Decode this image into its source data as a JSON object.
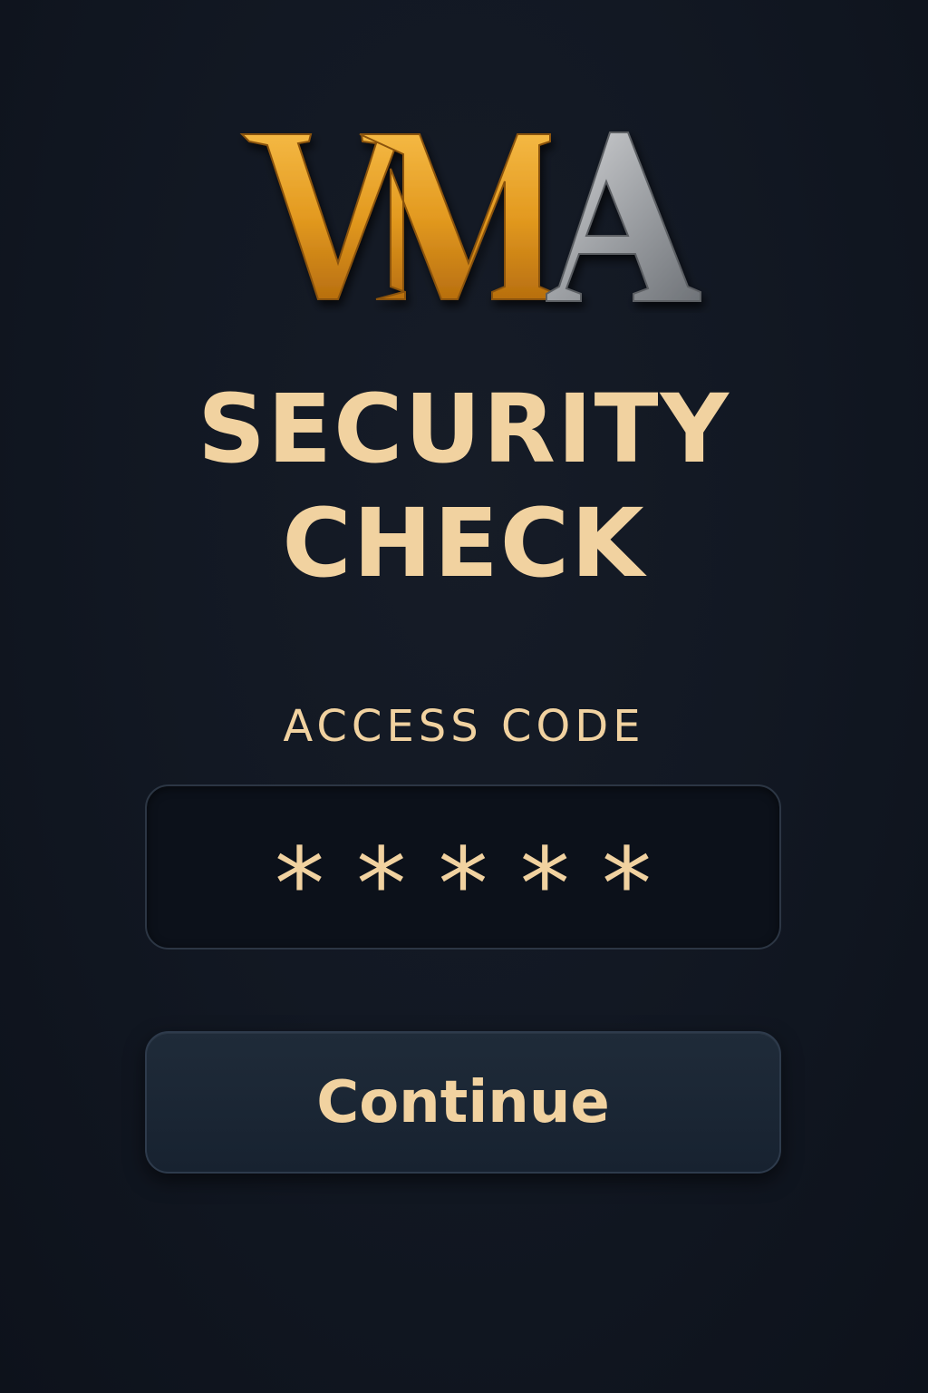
{
  "logo": {
    "text": "VMA",
    "icon": "vma-logo",
    "colors": {
      "gold": "#e39a20",
      "silver": "#a7a9ac"
    }
  },
  "header": {
    "title_line1": "SECURITY",
    "title_line2": "CHECK"
  },
  "form": {
    "label": "ACCESS CODE",
    "code_value": "*****"
  },
  "actions": {
    "continue_label": "Continue"
  },
  "theme": {
    "background": "#121823",
    "accent": "#f1d2a0",
    "field_background": "#0c111a",
    "button_background": "#1c2836"
  }
}
